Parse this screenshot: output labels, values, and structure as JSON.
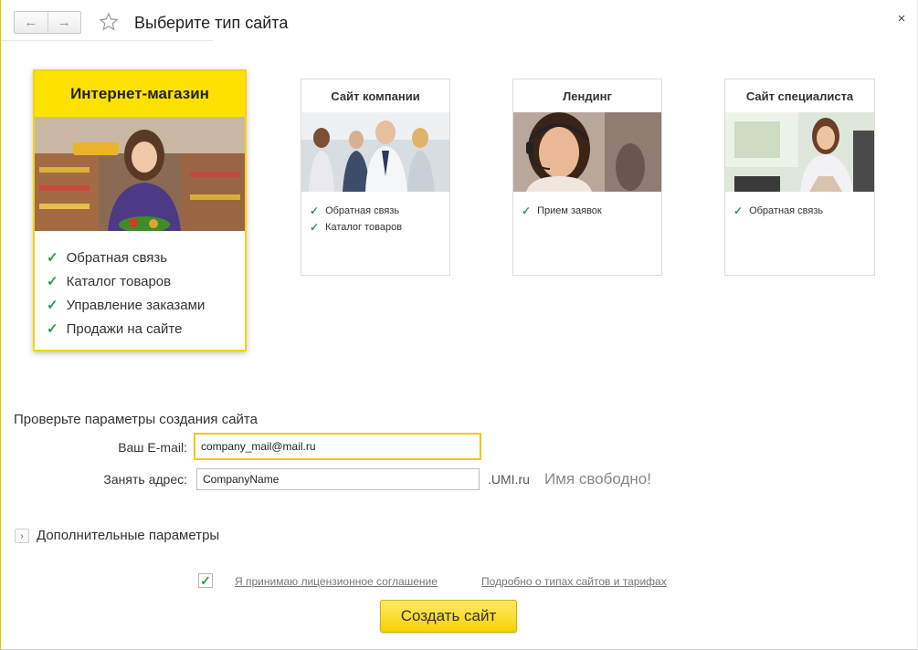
{
  "window": {
    "title": "Выберите тип сайта",
    "back_glyph": "←",
    "forward_glyph": "→",
    "close_glyph": "×"
  },
  "cards": [
    {
      "title": "Интернет-магазин",
      "selected": true,
      "features": [
        "Обратная связь",
        "Каталог товаров",
        "Управление заказами",
        "Продажи на сайте"
      ]
    },
    {
      "title": "Сайт компании",
      "selected": false,
      "features": [
        "Обратная связь",
        "Каталог товаров"
      ]
    },
    {
      "title": "Лендинг",
      "selected": false,
      "features": [
        "Прием заявок"
      ]
    },
    {
      "title": "Сайт специалиста",
      "selected": false,
      "features": [
        "Обратная связь"
      ]
    }
  ],
  "form": {
    "section_title": "Проверьте параметры создания сайта",
    "email_label": "Ваш E-mail:",
    "email_value": "company_mail@mail.ru",
    "address_label": "Занять адрес:",
    "address_value": "CompanyName",
    "domain_suffix": ".UMI.ru",
    "availability_status": "Имя свободно!"
  },
  "advanced": {
    "label": "Дополнительные параметры",
    "toggle_glyph": "›"
  },
  "agreement": {
    "checked": true,
    "check_glyph": "✓",
    "license_link": "Я принимаю лицензионное  соглашение",
    "details_link": "Подробно о типах сайтов и тарифах"
  },
  "create_button": "Создать сайт",
  "colors": {
    "accent_yellow": "#fde200",
    "check_green": "#2a9a4e"
  }
}
